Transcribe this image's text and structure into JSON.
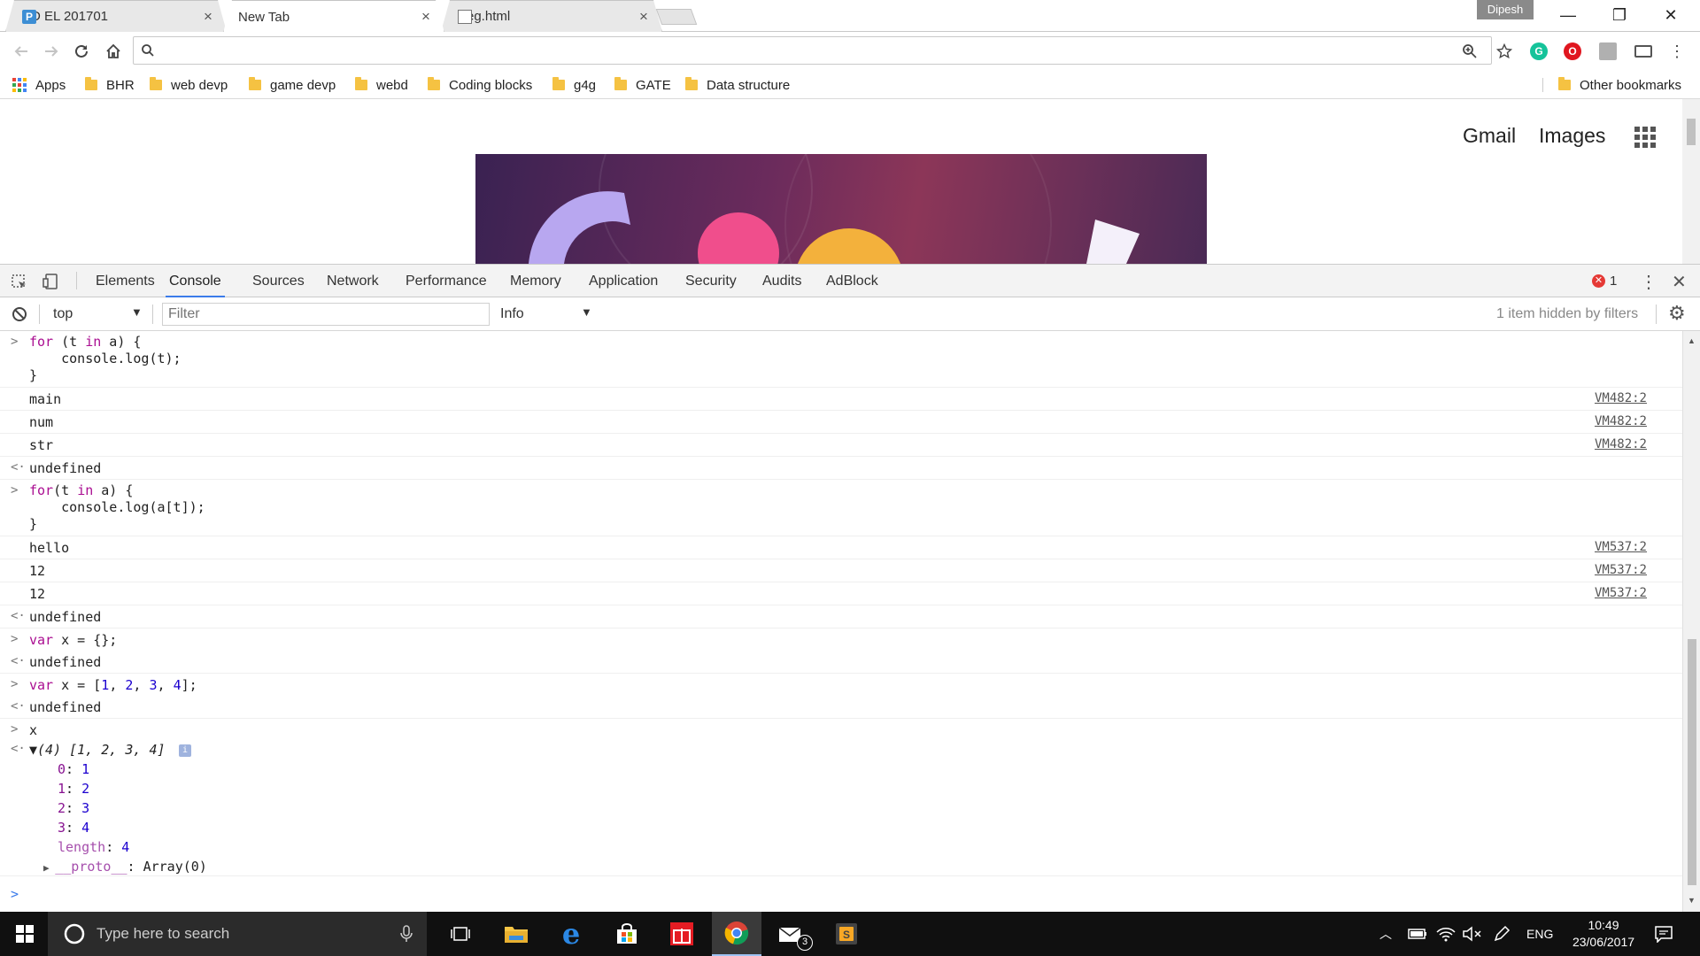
{
  "tabs": [
    {
      "title": "D EL 201701",
      "favicon": "p-icon"
    },
    {
      "title": "New Tab",
      "active": true
    },
    {
      "title": "eg.html",
      "favicon": "document-icon"
    }
  ],
  "profile": {
    "name": "Dipesh"
  },
  "window_controls": {
    "minimize": "—",
    "restore": "❐",
    "close": "✕"
  },
  "bookmarks": {
    "apps_label": "Apps",
    "items": [
      "BHR",
      "web devp",
      "game devp",
      "webd",
      "Coding blocks",
      "g4g",
      "GATE",
      "Data structure"
    ],
    "other": "Other bookmarks"
  },
  "page": {
    "gmail": "Gmail",
    "images": "Images"
  },
  "devtools": {
    "tabs": [
      "Elements",
      "Console",
      "Sources",
      "Network",
      "Performance",
      "Memory",
      "Application",
      "Security",
      "Audits",
      "AdBlock"
    ],
    "active_tab": "Console",
    "error_count": "1",
    "context": "top",
    "filter_placeholder": "Filter",
    "level": "Info",
    "hidden_msg": "1 item hidden by filters"
  },
  "console": {
    "code1_l1_kw": "for",
    "code1_l1_a": " (t ",
    "code1_l1_kw2": "in",
    "code1_l1_b": " a) {",
    "code1_l2": "    console.log(t);",
    "code1_l3": "}",
    "out1": [
      "main",
      "num",
      "str"
    ],
    "src1": "VM482:2",
    "undefined": "undefined",
    "code2_l1_kw": "for",
    "code2_l1_a": "(t ",
    "code2_l1_kw2": "in",
    "code2_l1_b": " a) {",
    "code2_l2": "    console.log(a[t]);",
    "code2_l3": "}",
    "out2": [
      "hello",
      "12",
      "12"
    ],
    "src2": "VM537:2",
    "cmd3_kw": "var",
    "cmd3_rest": " x = {};",
    "cmd4_kw": "var",
    "cmd4_a": " x = [",
    "cmd4_n1": "1",
    "cmd4_n2": "2",
    "cmd4_n3": "3",
    "cmd4_n4": "4",
    "cmd4_b": "];",
    "cmd5": "x",
    "array_summary": "(4) [1, 2, 3, 4]",
    "array_items": [
      {
        "key": "0",
        "value": "1"
      },
      {
        "key": "1",
        "value": "2"
      },
      {
        "key": "2",
        "value": "3"
      },
      {
        "key": "3",
        "value": "4"
      },
      {
        "key": "length",
        "value": "4"
      }
    ],
    "proto_key": "__proto__",
    "proto_value": "Array(0)"
  },
  "taskbar": {
    "search_placeholder": "Type here to search",
    "mail_badge": "3",
    "lang": "ENG",
    "time": "10:49",
    "date": "23/06/2017"
  },
  "colors": {
    "accent_blue": "#3b7bea",
    "keyword": "#aa0d91",
    "number": "#1c00cf"
  }
}
